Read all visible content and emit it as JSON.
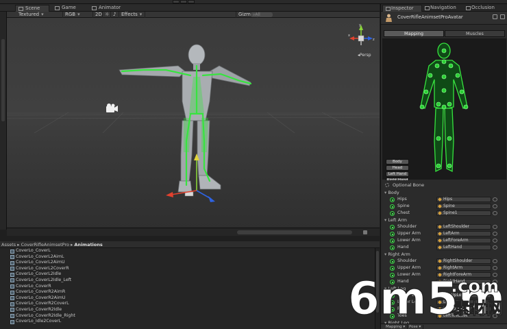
{
  "toolbar": {
    "play_icon": "play-icon",
    "pause_icon": "pause-icon",
    "step_icon": "step-icon"
  },
  "scene": {
    "tabs": [
      {
        "label": "Scene",
        "icon": "scene-icon",
        "active": true
      },
      {
        "label": "Game",
        "icon": "game-icon",
        "active": false
      },
      {
        "label": "Animator",
        "icon": "animator-icon",
        "active": false
      }
    ],
    "toolbar": {
      "render_mode": "Textured",
      "color_mode": "RGB",
      "mode_2d": "2D",
      "effects": "Effects",
      "gizmos": "Gizmos",
      "search_placeholder": "All"
    },
    "persp_label": "Persp",
    "gizmo_axes": {
      "y": "y",
      "x": "x",
      "z": "z"
    },
    "colors": {
      "bone_green": "#37e43f",
      "axis_x": "#e2412e",
      "axis_y": "#8ad43a",
      "axis_z": "#2e63e2"
    }
  },
  "project": {
    "breadcrumb": {
      "root": "Assets",
      "folder": "CoverRifleAnimsetPro",
      "current": "Animations"
    },
    "assets": [
      "CoverLo_CoverL",
      "CoverLo_CoverL2AimL",
      "CoverLo_CoverL2AimU",
      "CoverLo_CoverL2CoverR",
      "CoverLo_CoverL2Idle",
      "CoverLo_CoverL2Idle_Left",
      "CoverLo_CoverR",
      "CoverLo_CoverR2AimR",
      "CoverLo_CoverR2AimU",
      "CoverLo_CoverR2CoverL",
      "CoverLo_CoverR2Idle",
      "CoverLo_CoverR2Idle_Right",
      "CoverLo_Idle2CoverL"
    ]
  },
  "inspector": {
    "tabs": [
      {
        "label": "Inspector",
        "icon": "inspector-icon",
        "active": true
      },
      {
        "label": "Navigation",
        "icon": "navigation-icon",
        "active": false
      },
      {
        "label": "Occlusion",
        "icon": "occlusion-icon",
        "active": false
      }
    ],
    "title": "CoverRifleAnimsetProAvatar",
    "mapping_tab": "Mapping",
    "muscles_tab": "Muscles",
    "body_parts": [
      "Body",
      "Head",
      "Left Hand",
      "Right Hand"
    ],
    "optional_bone": "Optional Bone",
    "groups": [
      {
        "name": "Body",
        "bones": [
          {
            "label": "Hips",
            "value": "Hips"
          },
          {
            "label": "Spine",
            "value": "Spine"
          },
          {
            "label": "Chest",
            "value": "Spine1"
          }
        ]
      },
      {
        "name": "Left Arm",
        "bones": [
          {
            "label": "Shoulder",
            "value": "LeftShoulder"
          },
          {
            "label": "Upper Arm",
            "value": "LeftArm"
          },
          {
            "label": "Lower Arm",
            "value": "LeftForeArm"
          },
          {
            "label": "Hand",
            "value": "LeftHand"
          }
        ]
      },
      {
        "name": "Right Arm",
        "bones": [
          {
            "label": "Shoulder",
            "value": "RightShoulder"
          },
          {
            "label": "Upper Arm",
            "value": "RightArm"
          },
          {
            "label": "Lower Arm",
            "value": "RightForeArm"
          },
          {
            "label": "Hand",
            "value": "RightHand"
          }
        ]
      },
      {
        "name": "Left Leg",
        "bones": [
          {
            "label": "Upper Leg",
            "value": "LeftUpLeg"
          },
          {
            "label": "Lower Leg",
            "value": "LeftLeg"
          },
          {
            "label": "Foot",
            "value": "LeftFoot"
          },
          {
            "label": "Toes",
            "value": "LeftToeBase"
          }
        ]
      },
      {
        "name": "Right Leg",
        "bones": []
      }
    ],
    "bottom_buttons": [
      "Mapping",
      "Pose"
    ]
  },
  "watermark": {
    "brand": "6m5m",
    "domain": ".com",
    "cn_text": "素材网"
  }
}
